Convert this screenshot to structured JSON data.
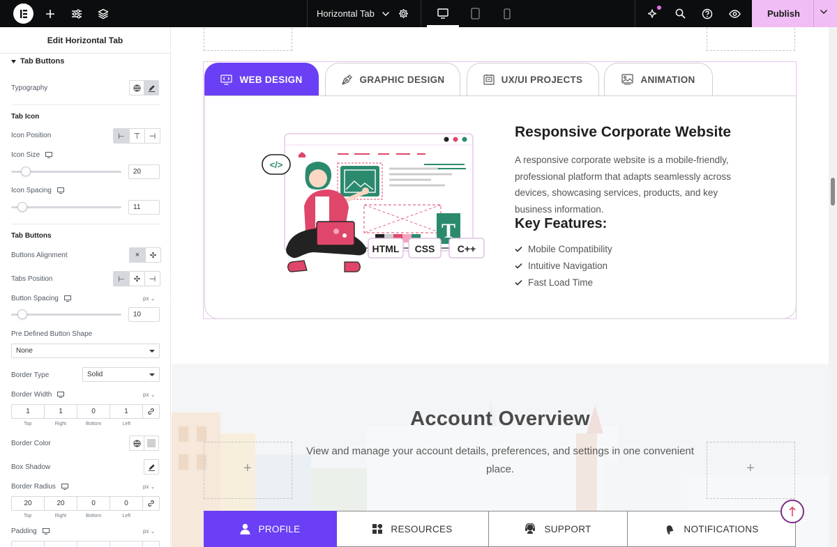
{
  "topbar": {
    "document_title": "Horizontal Tab",
    "publish_label": "Publish",
    "icons": [
      "elementor-logo-icon",
      "add-icon",
      "sliders-icon",
      "layers-icon",
      "chevron-down-icon",
      "gear-icon",
      "desktop-icon",
      "tablet-icon",
      "mobile-icon",
      "ai-sparkle-icon",
      "search-icon",
      "help-icon",
      "eye-icon"
    ],
    "accent_color": "#f0bdf5"
  },
  "panel": {
    "title": "Edit Horizontal Tab",
    "section_title": "Tab Buttons",
    "typography_label": "Typography",
    "tab_icon": {
      "heading": "Tab Icon",
      "icon_position_label": "Icon Position",
      "icon_size_label": "Icon Size",
      "icon_size_value": "20",
      "icon_size_level": 0.13,
      "icon_spacing_label": "Icon Spacing",
      "icon_spacing_value": "11",
      "icon_spacing_level": 0.1
    },
    "tab_buttons": {
      "heading": "Tab Buttons",
      "alignment_label": "Buttons Alignment",
      "tabs_position_label": "Tabs Position",
      "button_spacing_label": "Button Spacing",
      "button_spacing_unit": "px",
      "button_spacing_value": "10",
      "button_spacing_level": 0.1,
      "shape_label": "Pre Defined Button Shape",
      "shape_value": "None",
      "border_type_label": "Border Type",
      "border_type_value": "Solid",
      "border_width_label": "Border Width",
      "border_width_unit": "px",
      "border_width": [
        "1",
        "1",
        "0",
        "1"
      ],
      "dim_labels": [
        "Top",
        "Right",
        "Bottom",
        "Left"
      ],
      "border_color_label": "Border Color",
      "box_shadow_label": "Box Shadow",
      "border_radius_label": "Border Radius",
      "border_radius_unit": "px",
      "border_radius": [
        "20",
        "20",
        "0",
        "0"
      ],
      "padding_label": "Padding",
      "padding_unit": "px"
    }
  },
  "canvas": {
    "tabs": [
      {
        "label": "WEB DESIGN",
        "icon": "monitor-code-icon",
        "active": true
      },
      {
        "label": "GRAPHIC DESIGN",
        "icon": "pen-tool-icon",
        "active": false
      },
      {
        "label": "UX/UI PROJECTS",
        "icon": "ux-board-icon",
        "active": false
      },
      {
        "label": "ANIMATION",
        "icon": "animation-frame-icon",
        "active": false
      }
    ],
    "content": {
      "title": "Responsive Corporate Website",
      "description": "A responsive corporate website is a mobile-friendly, professional platform that adapts seamlessly across devices, showcasing services, products, and key business information.",
      "features_heading": "Key Features:",
      "features": [
        "Mobile Compatibility",
        "Intuitive Navigation",
        "Fast Load Time"
      ],
      "illustration_labels": [
        "HTML",
        "CSS",
        "C++"
      ]
    },
    "account": {
      "title": "Account Overview",
      "description": "View and manage your account details, preferences, and settings in one convenient place.",
      "tabs": [
        {
          "label": "PROFILE",
          "icon": "user-icon",
          "active": true
        },
        {
          "label": "RESOURCES",
          "icon": "grid-icon",
          "active": false
        },
        {
          "label": "SUPPORT",
          "icon": "headset-icon",
          "active": false
        },
        {
          "label": "NOTIFICATIONS",
          "icon": "bell-icon",
          "active": false
        }
      ]
    },
    "accent_color": "#6a3ff5"
  }
}
